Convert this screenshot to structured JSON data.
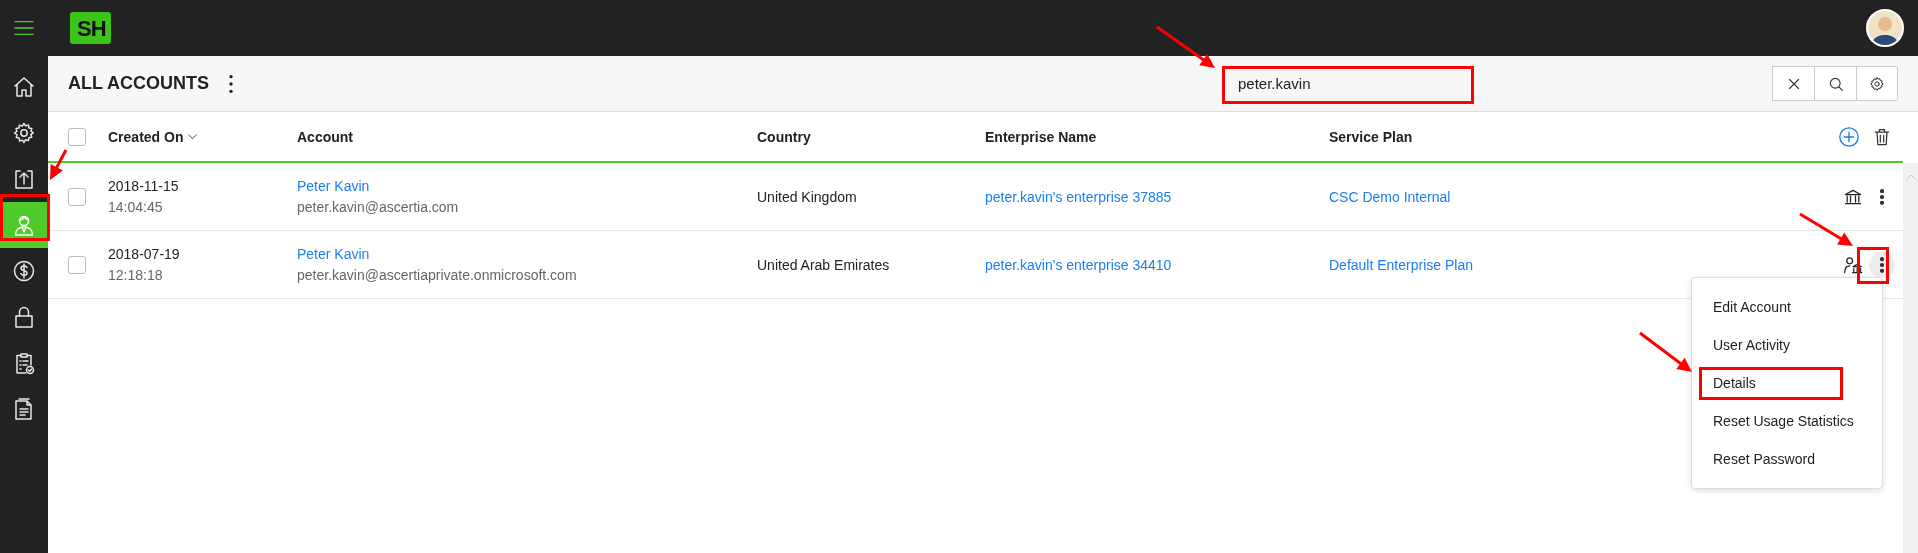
{
  "logo": "SH",
  "sidebar": {
    "items": [
      {
        "kind": "home",
        "selected": false
      },
      {
        "kind": "settings",
        "selected": false
      },
      {
        "kind": "upload",
        "selected": false
      },
      {
        "kind": "user",
        "selected": true
      },
      {
        "kind": "dollar",
        "selected": false
      },
      {
        "kind": "lock",
        "selected": false
      },
      {
        "kind": "clipboard",
        "selected": false
      },
      {
        "kind": "document",
        "selected": false
      }
    ]
  },
  "title": "ALL ACCOUNTS",
  "search": {
    "value": "peter.kavin"
  },
  "table": {
    "all_checked": false,
    "columns": [
      {
        "label": "Created On",
        "sorted": true
      },
      {
        "label": "Account",
        "sorted": false
      },
      {
        "label": "Country",
        "sorted": false
      },
      {
        "label": "Enterprise Name",
        "sorted": false
      },
      {
        "label": "Service Plan",
        "sorted": false
      }
    ],
    "rows": [
      {
        "checked": false,
        "date": "2018-11-15",
        "time": "14:04:45",
        "name": "Peter Kavin",
        "email": "peter.kavin@ascertia.com",
        "country": "United Kingdom",
        "enterprise": "peter.kavin's enterprise 37885",
        "plan": "CSC Demo Internal",
        "kind": "bank",
        "menu_open": false
      },
      {
        "checked": false,
        "date": "2018-07-19",
        "time": "12:18:18",
        "name": "Peter Kavin",
        "email": "peter.kavin@ascertiaprivate.onmicrosoft.com",
        "country": "United Arab Emirates",
        "enterprise": "peter.kavin's enterprise 34410",
        "plan": "Default Enterprise Plan",
        "kind": "user-bank",
        "menu_open": true
      }
    ]
  },
  "menu": {
    "items": [
      "Edit Account",
      "User Activity",
      "Details",
      "Reset Usage Statistics",
      "Reset Password"
    ]
  }
}
